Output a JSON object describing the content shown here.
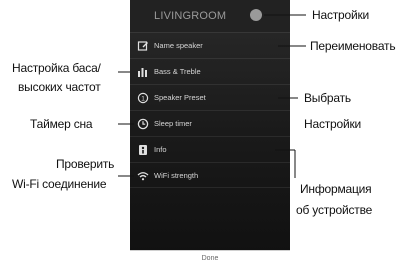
{
  "phone": {
    "room_title": "LIVINGROOM",
    "menu": [
      {
        "label": "Name speaker",
        "icon": "pencil-icon"
      },
      {
        "label": "Bass & Treble",
        "icon": "equalizer-icon"
      },
      {
        "label": "Speaker Preset",
        "icon": "preset-icon"
      },
      {
        "label": "Sleep timer",
        "icon": "clock-icon"
      },
      {
        "label": "Info",
        "icon": "info-icon"
      },
      {
        "label": "WiFi strength",
        "icon": "wifi-icon"
      }
    ],
    "done_label": "Done"
  },
  "callouts": {
    "settings": "Настройки",
    "rename": "Переименовать",
    "bass_line1": "Настройка баса/",
    "bass_line2": "высоких частот",
    "preset_line1": "Выбрать",
    "preset_line2": "Настройки",
    "sleep": "Таймер сна",
    "wifi_line1": "Проверить",
    "wifi_line2": "Wi-Fi соединение",
    "info_line1": "Информация",
    "info_line2": "об устройстве"
  },
  "colors": {
    "phone_background": "#1a1a1a",
    "menu_text": "#d6d6d6",
    "title_text": "#9a9a9a"
  }
}
